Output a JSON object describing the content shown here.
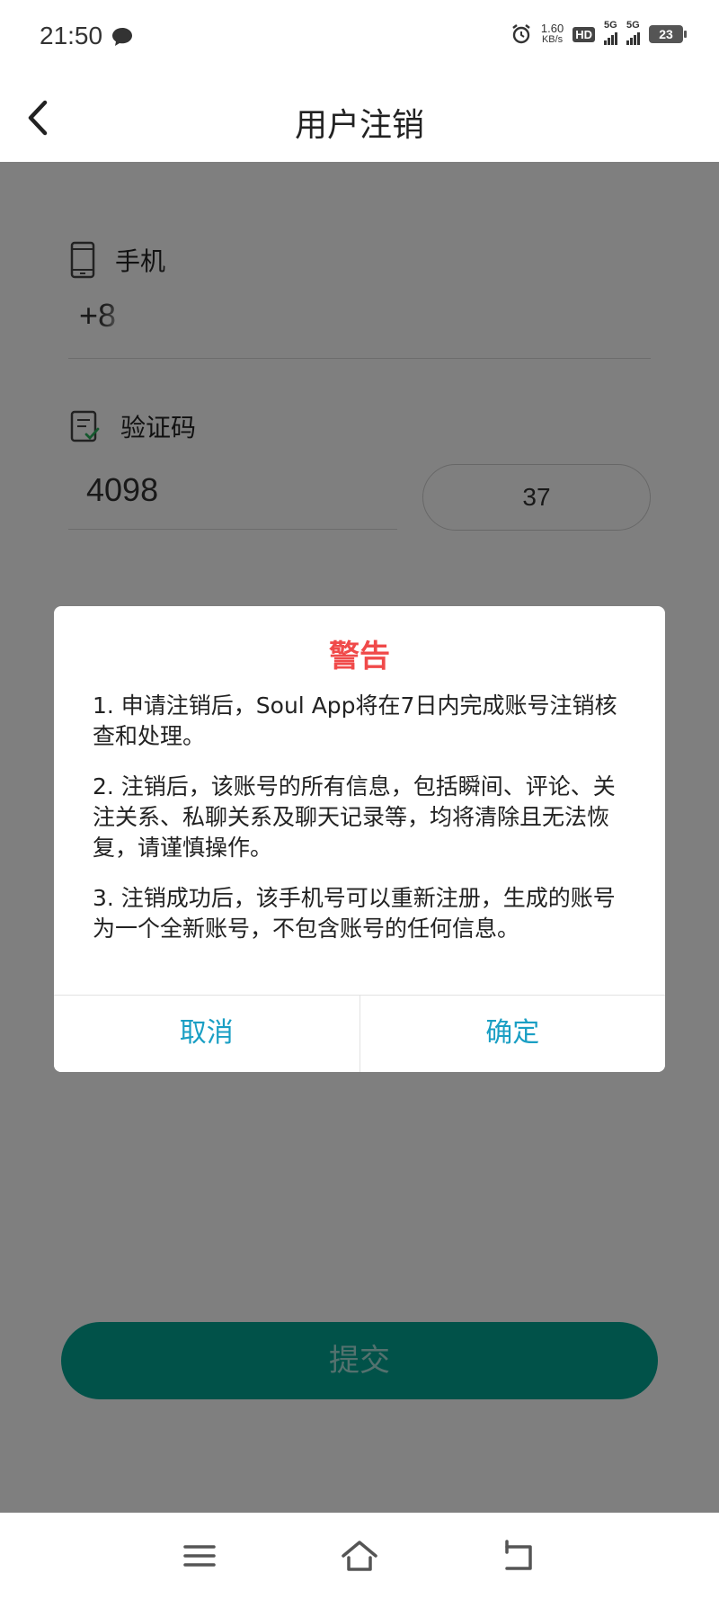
{
  "status_bar": {
    "time": "21:50",
    "net_speed_value": "1.60",
    "net_speed_unit": "KB/s",
    "hd_label": "HD",
    "signal1_label": "5G",
    "signal2_label": "5G",
    "battery": "23"
  },
  "header": {
    "title": "用户注销"
  },
  "form": {
    "phone_label": "手机",
    "phone_value": "+8",
    "code_label": "验证码",
    "code_value": "4098",
    "countdown": "37",
    "submit_label": "提交"
  },
  "dialog": {
    "title": "警告",
    "paragraphs": [
      "1. 申请注销后，Soul App将在7日内完成账号注销核查和处理。",
      "2. 注销后，该账号的所有信息，包括瞬间、评论、关注关系、私聊关系及聊天记录等，均将清除且无法恢复，请谨慎操作。",
      "3. 注销成功后，该手机号可以重新注册，生成的账号为一个全新账号，不包含账号的任何信息。"
    ],
    "cancel_label": "取消",
    "confirm_label": "确定"
  },
  "colors": {
    "accent_teal": "#02a593",
    "warning_red": "#f04a4a",
    "dialog_button_blue": "#1a9fc4"
  },
  "icons": [
    "message-bubble-icon",
    "alarm-icon",
    "phone-icon",
    "verify-code-icon",
    "back-arrow-icon",
    "menu-icon",
    "home-icon",
    "return-icon"
  ]
}
